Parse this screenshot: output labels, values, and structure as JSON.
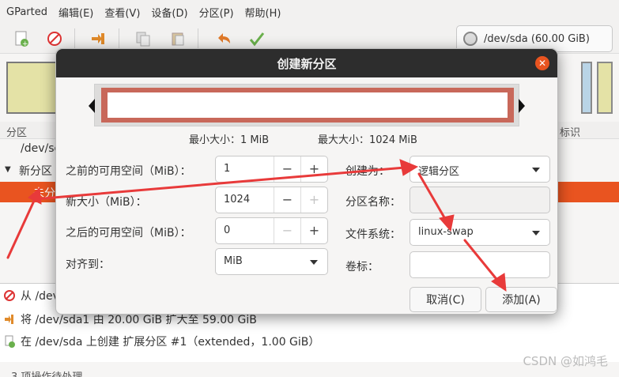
{
  "menubar": {
    "app": "GParted",
    "items": [
      "编辑(E)",
      "查看(V)",
      "设备(D)",
      "分区(P)",
      "帮助(H)"
    ]
  },
  "toolbar": {
    "icons": [
      "new-partition-icon",
      "delete-icon",
      "resize-move-icon",
      "copy-icon",
      "paste-icon",
      "undo-icon",
      "apply-icon"
    ]
  },
  "device": {
    "label": "/dev/sda (60.00 GiB)"
  },
  "table": {
    "header_left": "分区",
    "header_right": "标识",
    "rows": [
      "/dev/sd",
      "新分区",
      "未分"
    ]
  },
  "pending_ops": [
    {
      "icon": "delete-icon",
      "text": "从 /dev"
    },
    {
      "icon": "resize-move-icon",
      "text": "将 /dev/sda1 由 20.00 GiB 扩大至 59.00 GiB"
    },
    {
      "icon": "new-partition-icon",
      "text": "在 /dev/sda 上创建 扩展分区 #1（extended，1.00 GiB）"
    }
  ],
  "status": "3 项操作待处理",
  "watermark": "CSDN @如鸿毛",
  "dialog": {
    "title": "创建新分区",
    "min_size": "最小大小：1 MiB",
    "max_size": "最大大小：1024 MiB",
    "free_before": {
      "label": "之前的可用空间（MiB）：",
      "value": "1"
    },
    "new_size": {
      "label": "新大小（MiB）：",
      "value": "1024"
    },
    "free_after": {
      "label": "之后的可用空间（MiB）：",
      "value": "0"
    },
    "align": {
      "label": "对齐到：",
      "value": "MiB"
    },
    "create_as": {
      "label": "创建为：",
      "value": "逻辑分区"
    },
    "partition_name": {
      "label": "分区名称：",
      "value": ""
    },
    "filesystem": {
      "label": "文件系统：",
      "value": "linux-swap"
    },
    "volume_label": {
      "label": "卷标：",
      "value": ""
    },
    "cancel_label": "取消(C)",
    "add_label": "添加(A)"
  },
  "colors": {
    "accent": "#e95420",
    "annotation": "#e83a3a",
    "partition_border": "#c8685a"
  }
}
